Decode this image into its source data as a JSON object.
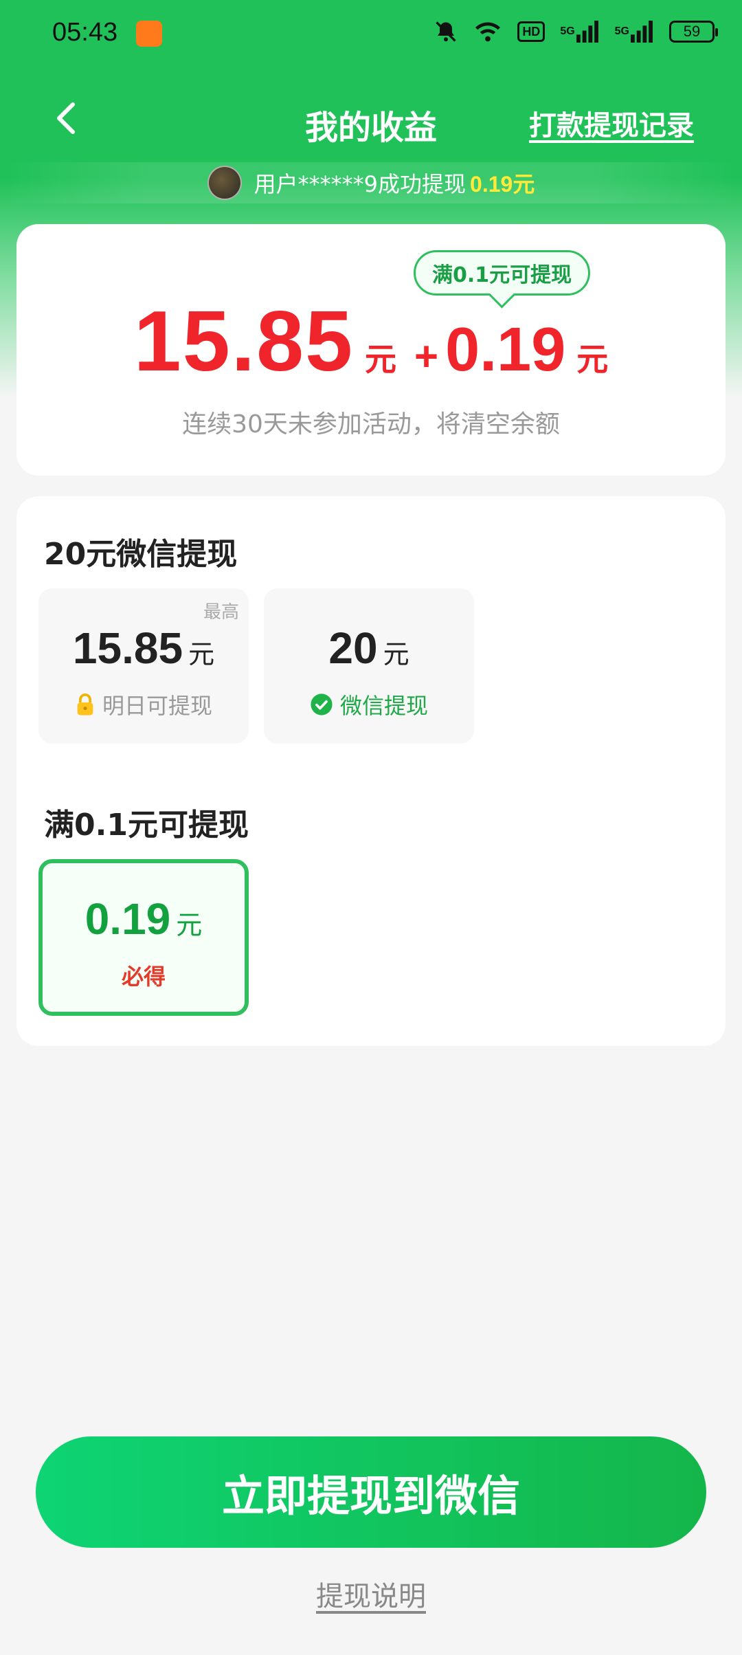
{
  "status_bar": {
    "time": "05:43",
    "hd_label": "HD",
    "signal1_label": "5G",
    "signal2_label": "5G",
    "battery": "59"
  },
  "nav": {
    "title": "我的收益",
    "record_link": "打款提现记录"
  },
  "notice": {
    "text": "用户******9成功提现",
    "amount": "0.19元"
  },
  "balance": {
    "tip": "满0.1元可提现",
    "main_amount": "15.85",
    "main_unit": "元",
    "plus": "+",
    "bonus_amount": "0.19",
    "bonus_unit": "元",
    "warning": "连续30天未参加活动，将清空余额"
  },
  "wechat_section": {
    "title": "20元微信提现",
    "options": [
      {
        "corner": "最高",
        "amount": "15.85",
        "unit": "元",
        "sub": "明日可提现"
      },
      {
        "amount": "20",
        "unit": "元",
        "sub": "微信提现"
      }
    ]
  },
  "small_section": {
    "title": "满0.1元可提现",
    "options": [
      {
        "amount": "0.19",
        "unit": "元",
        "sub": "必得"
      }
    ]
  },
  "cta": {
    "label": "立即提现到微信"
  },
  "help": {
    "label": "提现说明"
  },
  "colors": {
    "brand_green": "#1fc158",
    "amount_red": "#f0252b",
    "selected_border": "#2fbf5e"
  }
}
